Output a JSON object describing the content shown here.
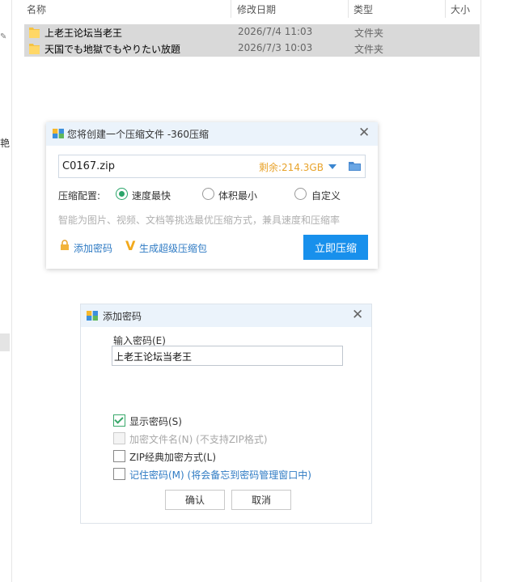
{
  "explorer": {
    "columns": {
      "name": "名称",
      "date": "修改日期",
      "type": "类型",
      "size": "大小"
    },
    "side_char": "艳",
    "rows": [
      {
        "name": "上老王论坛当老王",
        "date": "2026/7/4 11:03",
        "type": "文件夹"
      },
      {
        "name": "天国でも地獄でもやりたい放題",
        "date": "2026/7/3 10:03",
        "type": "文件夹"
      }
    ]
  },
  "compress_dialog": {
    "title": "您将创建一个压缩文件 -360压缩",
    "filename": "C0167.zip",
    "remaining": "剩余:214.3GB",
    "config_label": "压缩配置:",
    "options": [
      "速度最快",
      "体积最小",
      "自定义"
    ],
    "selected_option": "速度最快",
    "hint": "智能为图片、视频、文档等挑选最优压缩方式，兼具速度和压缩率",
    "add_password_link": "添加密码",
    "super_pack_link": "生成超级压缩包",
    "compress_button": "立即压缩",
    "accent_color": "#1890ec"
  },
  "password_dialog": {
    "title": "添加密码",
    "input_label": "输入密码(E)",
    "password_value": "上老王论坛当老王",
    "checkboxes": [
      {
        "label": "显示密码(S)",
        "checked": true,
        "enabled": true
      },
      {
        "label": "加密文件名(N) (不支持ZIP格式)",
        "checked": false,
        "enabled": false
      },
      {
        "label": "ZIP经典加密方式(L)",
        "checked": false,
        "enabled": true
      },
      {
        "label": "记住密码(M) (将会备忘到密码管理窗口中)",
        "checked": false,
        "enabled": true
      }
    ],
    "ok_button": "确认",
    "cancel_button": "取消"
  }
}
